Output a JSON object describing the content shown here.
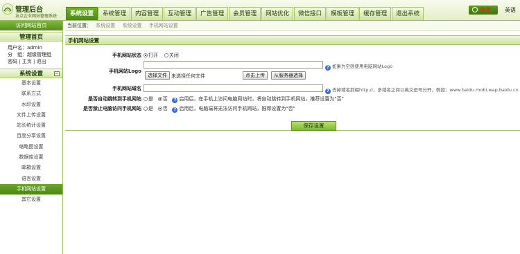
{
  "brand": {
    "title": "管理后台",
    "subtitle": "友点企业网站管理系统"
  },
  "nav_tabs": [
    "系统设置",
    "系统管理",
    "内容管理",
    "互动管理",
    "广告管理",
    "会员管理",
    "网站优化",
    "微信接口",
    "模板管理",
    "缓存管理",
    "退出系统"
  ],
  "lang": {
    "cn": "中文",
    "en": "英语"
  },
  "sidebar": {
    "home_label": "访问网站首页",
    "manage_title": "管理首页",
    "username_label": "用户名：admin",
    "group_label": "分　组：超级管理组",
    "links": "密码 | 主页 | 退出",
    "section_title": "系统设置",
    "collapse_symbol": "−",
    "items": [
      "基本设置",
      "联系方式",
      "水印设置",
      "文件上传设置",
      "站长统计设置",
      "百度分享设置",
      "缩略图设置",
      "数据库设置",
      "邮箱设置",
      "语言设置",
      "手机网站设置",
      "其它设置"
    ]
  },
  "breadcrumb": {
    "prefix": "当前位置：",
    "items": [
      "系统设置",
      "系统设置",
      "手机网站设置"
    ]
  },
  "panel_title": "手机网站设置",
  "form": {
    "status": {
      "label": "手机网站状态",
      "opt_on": "打开",
      "opt_off": "关闭"
    },
    "logo": {
      "label": "手机网站Logo",
      "hint": "如果为空则使用电脑网站Logo",
      "choose_btn": "选择文件",
      "no_file": "未选择任何文件",
      "upload_btn": "点击上传",
      "server_btn": "从服务器选择"
    },
    "domain": {
      "label": "手机网站域名",
      "hint": "去掉域名前缀http://，多域名之间以英文逗号分开，例如：www.baidu.mobi,wap.baidu.cn"
    },
    "auto_jump": {
      "label": "是否自动跳转到手机网站",
      "opt_yes": "是",
      "opt_no": "否",
      "hint": "启用后，在手机上访问电脑网站时，将自动跳转到手机网站，推荐设置为\"否\""
    },
    "block_pc": {
      "label": "是否禁止电脑访问手机网站",
      "opt_yes": "是",
      "opt_no": "否",
      "hint": "启用后，电脑端将无法访问手机网站，推荐设置为\"否\""
    }
  },
  "save_label": "保存设置",
  "help_icon_text": "?"
}
